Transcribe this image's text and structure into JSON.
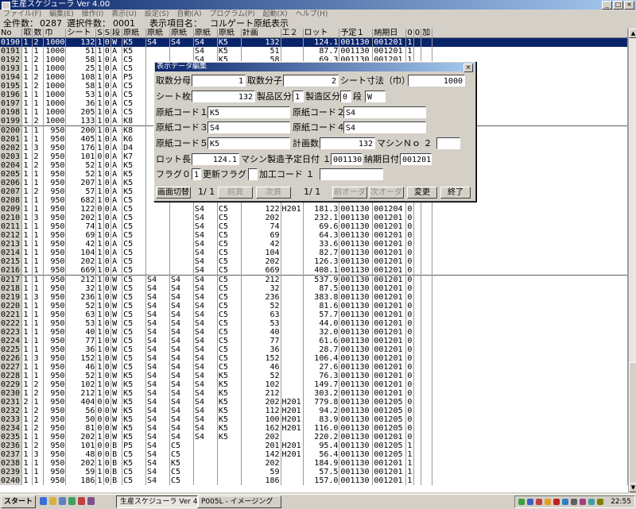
{
  "window": {
    "title": "生産スケジューラ Ver 4.00",
    "controls": [
      "_",
      "□",
      "×"
    ]
  },
  "menu": [
    "ファイル(F)",
    "編集(E)",
    "操作(I)",
    "表示(U)",
    "設定(S)",
    "自動(A)",
    "プログラム(P)",
    "起動(X)",
    "ヘルプ(H)"
  ],
  "info": {
    "total_label": "全件数：",
    "total": "0287",
    "selected_label": "選択件数：",
    "selected": "0001",
    "display_label": "表示項目名：",
    "display_item": "コルゲート原紙表示"
  },
  "table": {
    "headers": [
      "No",
      "取",
      "数",
      "巾",
      "シート",
      "S",
      "S",
      "段",
      "原紙",
      "原紙",
      "原紙",
      "原紙",
      "原紙",
      "計画",
      "工２",
      "ロット",
      "予定１",
      "納期日",
      "0",
      "0",
      "加"
    ],
    "selected_index": 0,
    "separators_before": [
      10,
      27
    ],
    "rows": [
      [
        "0190",
        "1",
        "2",
        "1000",
        "132",
        "1",
        "0",
        "W",
        "K5",
        "S4",
        "S4",
        "S4",
        "K5",
        "132",
        "",
        "124.1",
        "001130",
        "001201",
        "1",
        "",
        ""
      ],
      [
        "0191",
        "1",
        "1",
        "1000",
        "51",
        "1",
        "0",
        "A",
        "K5",
        "",
        "",
        "S4",
        "K5",
        "51",
        "",
        "87.7",
        "001130",
        "001201",
        "1",
        "",
        ""
      ],
      [
        "0192",
        "1",
        "2",
        "1000",
        "58",
        "1",
        "0",
        "A",
        "C5",
        "",
        "",
        "S4",
        "K5",
        "58",
        "",
        "69.3",
        "001130",
        "001201",
        "1",
        "",
        ""
      ],
      [
        "0193",
        "1",
        "1",
        "1000",
        "25",
        "1",
        "0",
        "A",
        "C5",
        "",
        "",
        "",
        "",
        "",
        "",
        "",
        "",
        "",
        "",
        "",
        ""
      ],
      [
        "0194",
        "1",
        "2",
        "1000",
        "108",
        "1",
        "0",
        "A",
        "P5",
        "",
        "",
        "",
        "",
        "",
        "",
        "",
        "",
        "",
        "",
        "",
        ""
      ],
      [
        "0195",
        "1",
        "2",
        "1000",
        "58",
        "1",
        "0",
        "A",
        "C5",
        "",
        "",
        "",
        "",
        "",
        "",
        "",
        "",
        "",
        "",
        "",
        ""
      ],
      [
        "0196",
        "1",
        "1",
        "1000",
        "53",
        "1",
        "0",
        "A",
        "C5",
        "",
        "",
        "",
        "",
        "",
        "",
        "",
        "",
        "",
        "",
        "",
        ""
      ],
      [
        "0197",
        "1",
        "1",
        "1000",
        "36",
        "1",
        "0",
        "A",
        "C5",
        "",
        "",
        "",
        "",
        "",
        "",
        "",
        "",
        "",
        "",
        "",
        ""
      ],
      [
        "0198",
        "1",
        "1",
        "1000",
        "205",
        "1",
        "0",
        "A",
        "C5",
        "",
        "",
        "",
        "",
        "",
        "",
        "",
        "",
        "",
        "",
        "",
        ""
      ],
      [
        "0199",
        "1",
        "2",
        "1000",
        "133",
        "1",
        "0",
        "A",
        "K8",
        "",
        "",
        "",
        "",
        "",
        "",
        "",
        "",
        "",
        "",
        "",
        ""
      ],
      [
        "0200",
        "1",
        "1",
        "950",
        "200",
        "1",
        "0",
        "A",
        "K8",
        "",
        "",
        "",
        "",
        "",
        "",
        "",
        "",
        "",
        "",
        "",
        ""
      ],
      [
        "0201",
        "1",
        "1",
        "950",
        "405",
        "1",
        "0",
        "A",
        "K6",
        "",
        "",
        "",
        "",
        "",
        "",
        "",
        "",
        "",
        "",
        "",
        ""
      ],
      [
        "0202",
        "1",
        "3",
        "950",
        "176",
        "1",
        "0",
        "A",
        "D4",
        "",
        "",
        "",
        "",
        "",
        "",
        "",
        "",
        "",
        "",
        "",
        ""
      ],
      [
        "0203",
        "1",
        "2",
        "950",
        "101",
        "0",
        "0",
        "A",
        "K7",
        "",
        "",
        "",
        "",
        "",
        "",
        "",
        "",
        "",
        "",
        "",
        ""
      ],
      [
        "0204",
        "1",
        "2",
        "950",
        "52",
        "1",
        "0",
        "A",
        "K5",
        "",
        "",
        "",
        "",
        "",
        "",
        "",
        "",
        "",
        "",
        "",
        ""
      ],
      [
        "0205",
        "1",
        "1",
        "950",
        "52",
        "1",
        "0",
        "A",
        "K5",
        "",
        "",
        "",
        "",
        "",
        "",
        "",
        "",
        "",
        "",
        "",
        ""
      ],
      [
        "0206",
        "1",
        "1",
        "950",
        "207",
        "1",
        "0",
        "A",
        "K5",
        "",
        "",
        "",
        "",
        "",
        "",
        "",
        "",
        "",
        "",
        "",
        ""
      ],
      [
        "0207",
        "1",
        "2",
        "950",
        "57",
        "1",
        "0",
        "A",
        "K5",
        "",
        "",
        "",
        "",
        "",
        "",
        "",
        "",
        "",
        "",
        "",
        ""
      ],
      [
        "0208",
        "1",
        "1",
        "950",
        "682",
        "1",
        "0",
        "A",
        "C5",
        "",
        "",
        "S4",
        "C5",
        "682",
        "",
        "903.0",
        "001130",
        "001201",
        "0",
        "",
        ""
      ],
      [
        "0209",
        "1",
        "1",
        "950",
        "122",
        "0",
        "0",
        "A",
        "C5",
        "",
        "",
        "S4",
        "C5",
        "122",
        "H201",
        "181.3",
        "001130",
        "001204",
        "0",
        "",
        ""
      ],
      [
        "0210",
        "1",
        "3",
        "950",
        "202",
        "1",
        "0",
        "A",
        "C5",
        "",
        "",
        "S4",
        "C5",
        "202",
        "",
        "232.1",
        "001130",
        "001201",
        "0",
        "",
        ""
      ],
      [
        "0211",
        "1",
        "1",
        "950",
        "74",
        "1",
        "0",
        "A",
        "C5",
        "",
        "",
        "S4",
        "C5",
        "74",
        "",
        "69.6",
        "001130",
        "001201",
        "0",
        "",
        ""
      ],
      [
        "0212",
        "1",
        "1",
        "950",
        "69",
        "1",
        "0",
        "A",
        "C5",
        "",
        "",
        "S4",
        "C5",
        "69",
        "",
        "64.3",
        "001130",
        "001201",
        "0",
        "",
        ""
      ],
      [
        "0213",
        "1",
        "1",
        "950",
        "42",
        "1",
        "0",
        "A",
        "C5",
        "",
        "",
        "S4",
        "C5",
        "42",
        "",
        "33.6",
        "001130",
        "001201",
        "0",
        "",
        ""
      ],
      [
        "0214",
        "1",
        "1",
        "950",
        "104",
        "1",
        "0",
        "A",
        "C5",
        "",
        "",
        "S4",
        "C5",
        "104",
        "",
        "82.7",
        "001130",
        "001201",
        "0",
        "",
        ""
      ],
      [
        "0215",
        "1",
        "1",
        "950",
        "202",
        "1",
        "0",
        "A",
        "C5",
        "",
        "",
        "S4",
        "C5",
        "202",
        "",
        "126.3",
        "001130",
        "001201",
        "0",
        "",
        ""
      ],
      [
        "0216",
        "1",
        "1",
        "950",
        "669",
        "1",
        "0",
        "A",
        "C5",
        "",
        "",
        "S4",
        "C5",
        "669",
        "",
        "408.1",
        "001130",
        "001201",
        "0",
        "",
        ""
      ],
      [
        "0217",
        "1",
        "1",
        "950",
        "212",
        "1",
        "0",
        "W",
        "C5",
        "S4",
        "S4",
        "S4",
        "C5",
        "212",
        "",
        "537.9",
        "001130",
        "001201",
        "0",
        "",
        ""
      ],
      [
        "0218",
        "1",
        "1",
        "950",
        "32",
        "1",
        "0",
        "W",
        "C5",
        "S4",
        "S4",
        "S4",
        "C5",
        "32",
        "",
        "87.5",
        "001130",
        "001201",
        "0",
        "",
        ""
      ],
      [
        "0219",
        "1",
        "3",
        "950",
        "236",
        "1",
        "0",
        "W",
        "C5",
        "S4",
        "S4",
        "S4",
        "C5",
        "236",
        "",
        "383.8",
        "001130",
        "001201",
        "0",
        "",
        ""
      ],
      [
        "0220",
        "1",
        "1",
        "950",
        "52",
        "1",
        "0",
        "W",
        "C5",
        "S4",
        "S4",
        "S4",
        "C5",
        "52",
        "",
        "81.6",
        "001130",
        "001201",
        "0",
        "",
        ""
      ],
      [
        "0221",
        "1",
        "1",
        "950",
        "63",
        "1",
        "0",
        "W",
        "C5",
        "S4",
        "S4",
        "S4",
        "C5",
        "63",
        "",
        "57.7",
        "001130",
        "001201",
        "0",
        "",
        ""
      ],
      [
        "0222",
        "1",
        "1",
        "950",
        "53",
        "1",
        "0",
        "W",
        "C5",
        "S4",
        "S4",
        "S4",
        "C5",
        "53",
        "",
        "44.0",
        "001130",
        "001201",
        "0",
        "",
        ""
      ],
      [
        "0223",
        "1",
        "1",
        "950",
        "40",
        "1",
        "0",
        "W",
        "C5",
        "S4",
        "S4",
        "S4",
        "C5",
        "40",
        "",
        "32.0",
        "001130",
        "001201",
        "0",
        "",
        ""
      ],
      [
        "0224",
        "1",
        "1",
        "950",
        "77",
        "1",
        "0",
        "W",
        "C5",
        "S4",
        "S4",
        "S4",
        "C5",
        "77",
        "",
        "61.6",
        "001130",
        "001201",
        "0",
        "",
        ""
      ],
      [
        "0225",
        "1",
        "1",
        "950",
        "36",
        "1",
        "0",
        "W",
        "C5",
        "S4",
        "S4",
        "S4",
        "C5",
        "36",
        "",
        "28.7",
        "001130",
        "001201",
        "0",
        "",
        ""
      ],
      [
        "0226",
        "1",
        "3",
        "950",
        "152",
        "1",
        "0",
        "W",
        "C5",
        "S4",
        "S4",
        "S4",
        "C5",
        "152",
        "",
        "106.4",
        "001130",
        "001201",
        "0",
        "",
        ""
      ],
      [
        "0227",
        "1",
        "1",
        "950",
        "46",
        "1",
        "0",
        "W",
        "C5",
        "S4",
        "S4",
        "S4",
        "C5",
        "46",
        "",
        "27.6",
        "001130",
        "001201",
        "0",
        "",
        ""
      ],
      [
        "0228",
        "1",
        "1",
        "950",
        "52",
        "1",
        "0",
        "W",
        "K5",
        "S4",
        "S4",
        "S4",
        "K5",
        "52",
        "",
        "76.3",
        "001130",
        "001201",
        "0",
        "",
        ""
      ],
      [
        "0229",
        "1",
        "2",
        "950",
        "102",
        "1",
        "0",
        "W",
        "K5",
        "S4",
        "S4",
        "S4",
        "K5",
        "102",
        "",
        "149.7",
        "001130",
        "001201",
        "0",
        "",
        ""
      ],
      [
        "0230",
        "1",
        "2",
        "950",
        "212",
        "1",
        "0",
        "W",
        "K5",
        "S4",
        "S4",
        "S4",
        "K5",
        "212",
        "",
        "303.2",
        "001130",
        "001201",
        "0",
        "",
        ""
      ],
      [
        "0231",
        "2",
        "1",
        "950",
        "404",
        "0",
        "0",
        "W",
        "K5",
        "S4",
        "S4",
        "S4",
        "K5",
        "202",
        "H201",
        "779.8",
        "001130",
        "001205",
        "0",
        "",
        ""
      ],
      [
        "0232",
        "1",
        "2",
        "950",
        "56",
        "0",
        "0",
        "W",
        "K5",
        "S4",
        "S4",
        "S4",
        "K5",
        "112",
        "H201",
        "94.2",
        "001130",
        "001205",
        "0",
        "",
        ""
      ],
      [
        "0233",
        "1",
        "2",
        "950",
        "50",
        "0",
        "0",
        "W",
        "K5",
        "S4",
        "S4",
        "S4",
        "K5",
        "100",
        "H201",
        "83.9",
        "001130",
        "001205",
        "0",
        "",
        ""
      ],
      [
        "0234",
        "1",
        "2",
        "950",
        "81",
        "0",
        "0",
        "W",
        "K5",
        "S4",
        "S4",
        "S4",
        "K5",
        "162",
        "H201",
        "116.0",
        "001130",
        "001205",
        "0",
        "",
        ""
      ],
      [
        "0235",
        "1",
        "1",
        "950",
        "202",
        "1",
        "0",
        "W",
        "K5",
        "S4",
        "S4",
        "S4",
        "K5",
        "202",
        "",
        "220.2",
        "001130",
        "001201",
        "0",
        "",
        ""
      ],
      [
        "0236",
        "1",
        "2",
        "950",
        "101",
        "0",
        "0",
        "B",
        "P5",
        "S4",
        "C5",
        "",
        "",
        "201",
        "H201",
        "95.4",
        "001130",
        "001205",
        "1",
        "",
        ""
      ],
      [
        "0237",
        "1",
        "3",
        "950",
        "48",
        "0",
        "0",
        "B",
        "C5",
        "S4",
        "C5",
        "",
        "",
        "142",
        "H201",
        "56.4",
        "001130",
        "001205",
        "1",
        "",
        ""
      ],
      [
        "0238",
        "1",
        "1",
        "950",
        "202",
        "1",
        "0",
        "B",
        "K5",
        "S4",
        "K5",
        "",
        "",
        "202",
        "",
        "184.9",
        "001130",
        "001201",
        "1",
        "",
        ""
      ],
      [
        "0239",
        "1",
        "1",
        "950",
        "59",
        "1",
        "0",
        "B",
        "C5",
        "S4",
        "C5",
        "",
        "",
        "59",
        "",
        "57.5",
        "001130",
        "001201",
        "1",
        "",
        ""
      ],
      [
        "0240",
        "1",
        "1",
        "950",
        "186",
        "1",
        "0",
        "B",
        "C5",
        "S4",
        "C5",
        "",
        "",
        "186",
        "",
        "157.0",
        "001130",
        "001201",
        "1",
        "",
        ""
      ]
    ]
  },
  "dialog": {
    "title": "表示データ編集",
    "close": "×",
    "labels": {
      "bunbo": "取数分母",
      "bunshi": "取数分子",
      "sheet_size": "シート寸法（巾）",
      "sheet_count": "シート枚数",
      "product_kbn": "製品区分",
      "mfg_kbn": "製造区分",
      "dan": "段",
      "genshi1": "原紙コード１",
      "genshi2": "原紙コード２",
      "genshi3": "原紙コード３",
      "genshi4": "原紙コード４",
      "genshi5": "原紙コード５",
      "plan_count": "計画数",
      "machine_no": "マシンＮｏ ２",
      "lot_len": "ロット長",
      "machine_date": "マシン製造予定日付 １",
      "due_date": "納期日付",
      "flag0": "フラグ０",
      "update_flag": "更新フラグ",
      "proc_code": "加工コード １"
    },
    "values": {
      "bunbo": "1",
      "bunshi": "2",
      "sheet_size": "1000",
      "sheet_count": "132",
      "product_kbn": "1",
      "mfg_kbn": "0",
      "dan": "W",
      "genshi1": "K5",
      "genshi2": "S4",
      "genshi3": "S4",
      "genshi4": "S4",
      "genshi5": "K5",
      "plan_count": "132",
      "machine_no": "",
      "lot_len": "124.1",
      "machine_date": "001130",
      "due_date": "001201",
      "flag0": "1",
      "update_flag": "",
      "proc_code": ""
    },
    "buttons": {
      "switch_screen": "画面切替",
      "page1": "1/ 1",
      "prev_page": "前頁",
      "next_page": "次頁",
      "page2": "1/ 1",
      "prev_order": "前オーダ",
      "next_order": "次オーダ",
      "change": "変更",
      "exit": "終了"
    }
  },
  "taskbar": {
    "start": "スタート",
    "tasks": [
      "生産スケジューラ Ver 4...",
      "P005L - イメージング"
    ],
    "clock": "22:55"
  }
}
